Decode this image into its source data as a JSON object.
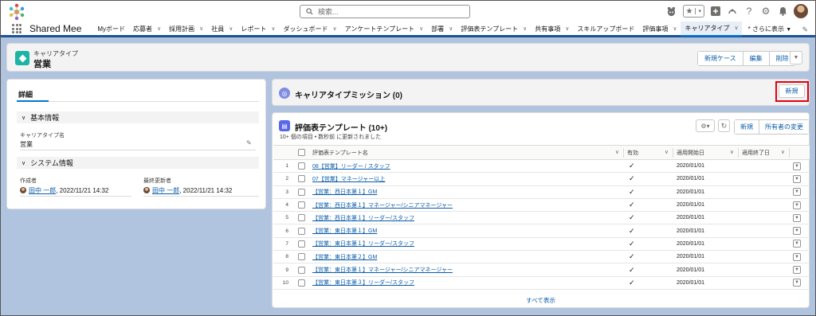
{
  "header": {
    "search_placeholder": "検索...",
    "icons": [
      "favorites-icon",
      "add-icon",
      "trailhead-icon",
      "help-icon",
      "setup-gear-icon",
      "notifications-bell-icon",
      "user-avatar"
    ]
  },
  "nav": {
    "app_name": "Shared Mee",
    "items": [
      {
        "label": "Myボード",
        "dropdown": false
      },
      {
        "label": "応募者",
        "dropdown": true
      },
      {
        "label": "採用計画",
        "dropdown": true
      },
      {
        "label": "社員",
        "dropdown": true
      },
      {
        "label": "レポート",
        "dropdown": true
      },
      {
        "label": "ダッシュボード",
        "dropdown": true
      },
      {
        "label": "アンケートテンプレート",
        "dropdown": true
      },
      {
        "label": "部署",
        "dropdown": true
      },
      {
        "label": "評価表テンプレート",
        "dropdown": true
      },
      {
        "label": "共有事項",
        "dropdown": true
      },
      {
        "label": "スキルアップボード",
        "dropdown": false
      },
      {
        "label": "評価事項",
        "dropdown": true
      },
      {
        "label": "キャリアタイプ",
        "dropdown": true,
        "active": true
      }
    ],
    "more_label": "* さらに表示"
  },
  "record": {
    "object_type": "キャリアタイプ",
    "name": "営業",
    "actions": [
      "新規ケース",
      "編集",
      "削除"
    ]
  },
  "details": {
    "tab_label": "詳細",
    "section_basic": "基本情報",
    "field_name_label": "キャリアタイプ名",
    "field_name_value": "営業",
    "section_system": "システム情報",
    "created_by_label": "作成者",
    "created_by_user": "田中 一郎",
    "created_by_date": ", 2022/11/21 14:32",
    "modified_by_label": "最終更新者",
    "modified_by_user": "田中 一郎",
    "modified_by_date": ", 2022/11/21 14:32"
  },
  "missions": {
    "title": "キャリアタイプミッション (0)",
    "new_button": "新規"
  },
  "templates": {
    "title": "評価表テンプレート (10+)",
    "subtitle": "10+ 個の項目 • 数秒前 に更新されました",
    "new_button": "新規",
    "change_owner_button": "所有者の変更",
    "columns": [
      "評価表テンプレート名",
      "有効",
      "適用開始日",
      "適用終了日"
    ],
    "rows": [
      {
        "no": "1",
        "name": "08【営業】リーダー / スタッフ",
        "active": "✓",
        "start": "2020/01/01",
        "end": ""
      },
      {
        "no": "2",
        "name": "07【営業】マネージャー以上",
        "active": "✓",
        "start": "2020/01/01",
        "end": ""
      },
      {
        "no": "3",
        "name": "【営業：西日本第１】GM",
        "active": "✓",
        "start": "2020/01/01",
        "end": ""
      },
      {
        "no": "4",
        "name": "【営業：西日本第１】マネージャー/シニアマネージャー",
        "active": "✓",
        "start": "2020/01/01",
        "end": ""
      },
      {
        "no": "5",
        "name": "【営業：西日本第１】リーダー/スタッフ",
        "active": "✓",
        "start": "2020/01/01",
        "end": ""
      },
      {
        "no": "6",
        "name": "【営業：東日本第１】GM",
        "active": "✓",
        "start": "2020/01/01",
        "end": ""
      },
      {
        "no": "7",
        "name": "【営業：東日本第１】リーダー/スタッフ",
        "active": "✓",
        "start": "2020/01/01",
        "end": ""
      },
      {
        "no": "8",
        "name": "【営業：東日本第２】GM",
        "active": "✓",
        "start": "2020/01/01",
        "end": ""
      },
      {
        "no": "9",
        "name": "【営業：東日本第１】マネージャー/シニアマネージャー",
        "active": "✓",
        "start": "2020/01/01",
        "end": ""
      },
      {
        "no": "10",
        "name": "【営業：東日本第３】リーダー/スタッフ",
        "active": "✓",
        "start": "2020/01/01",
        "end": ""
      }
    ],
    "view_all": "すべて表示"
  },
  "colors": {
    "brand": "#1b5297",
    "link": "#0b5cab",
    "record_icon": "#1cb4a4",
    "highlight": "#e3000f"
  }
}
